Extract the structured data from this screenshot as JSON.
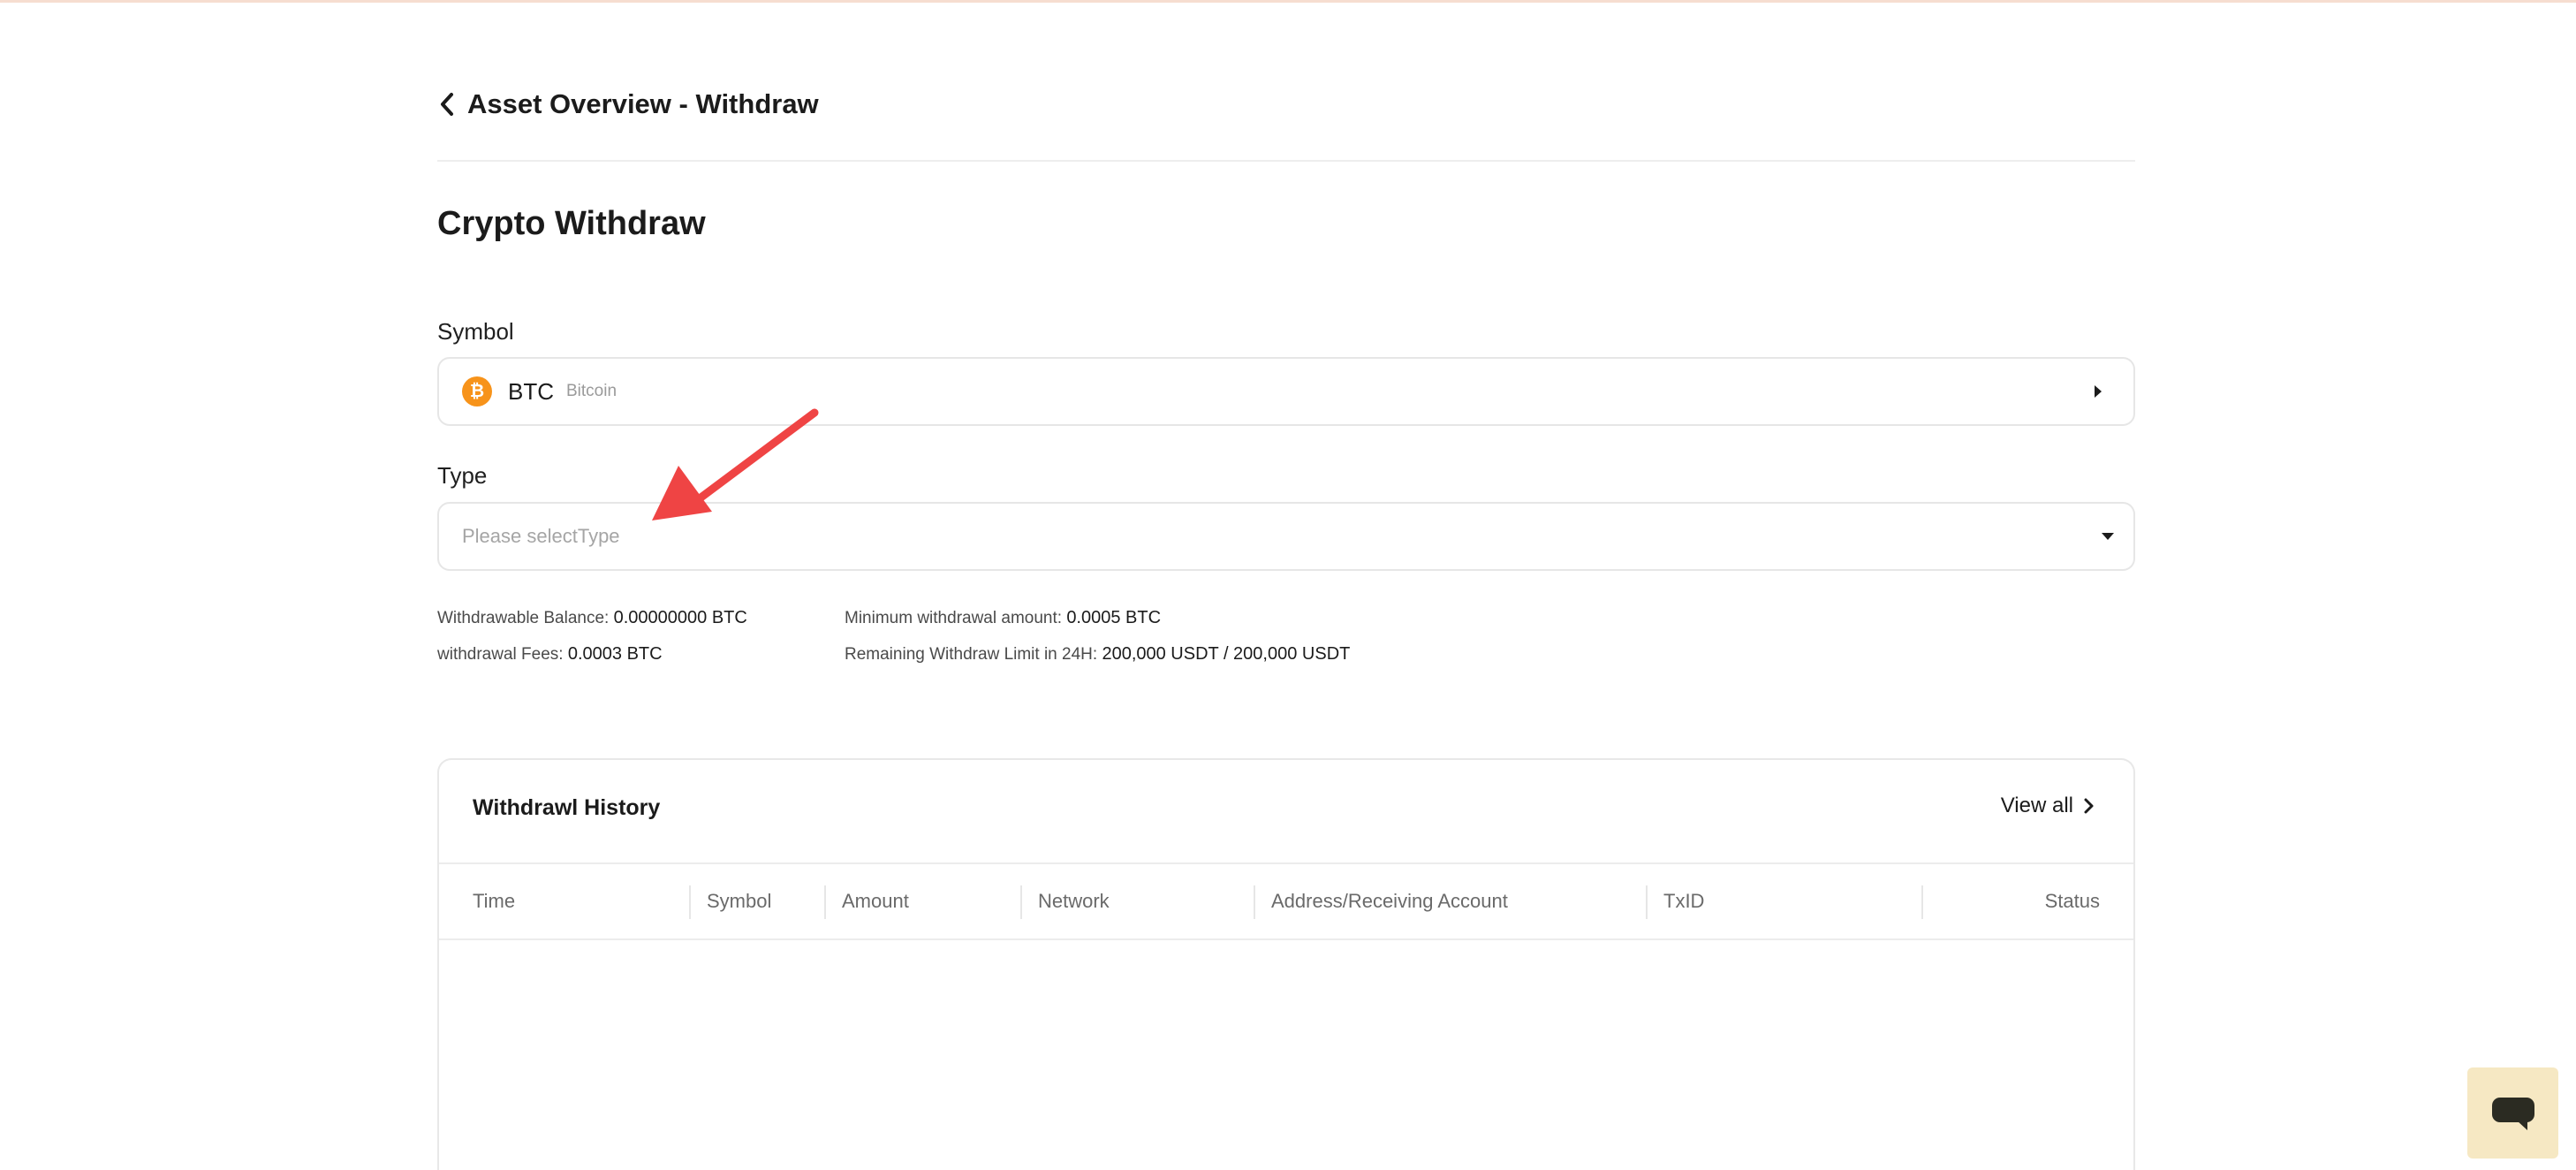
{
  "header": {
    "breadcrumb_title": "Asset Overview - Withdraw",
    "page_title": "Crypto Withdraw"
  },
  "form": {
    "symbol_label": "Symbol",
    "symbol_selected": {
      "symbol": "BTC",
      "name": "Bitcoin",
      "icon_glyph": "₿",
      "icon_color": "#f7931a"
    },
    "type_label": "Type",
    "type_placeholder": "Please selectType"
  },
  "info": {
    "withdrawable_label": "Withdrawable Balance:",
    "withdrawable_value": "0.00000000 BTC",
    "fees_label": "withdrawal Fees:",
    "fees_value": "0.0003 BTC",
    "min_label": "Minimum withdrawal amount:",
    "min_value": "0.0005 BTC",
    "limit_label": "Remaining Withdraw Limit in 24H:",
    "limit_value": "200,000 USDT / 200,000 USDT"
  },
  "history": {
    "title": "Withdrawl History",
    "view_all": "View all",
    "columns": [
      "Time",
      "Symbol",
      "Amount",
      "Network",
      "Address/Receiving Account",
      "TxID",
      "Status"
    ]
  },
  "colors": {
    "accent_top": "#f6ddd0",
    "annotation_arrow": "#ef4444",
    "chat_widget_bg": "#f6e8c3"
  },
  "icons": {
    "back": "chevron-left-icon",
    "symbol_dropdown": "caret-right-icon",
    "type_dropdown": "caret-down-icon",
    "view_all": "chevron-right-icon",
    "chat": "chat-bubble-icon"
  }
}
